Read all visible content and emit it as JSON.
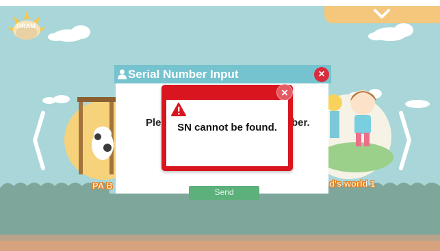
{
  "app": {
    "logo_text": "DRAM"
  },
  "carousel": {
    "left_label": "PA B",
    "right_label": "d's world 1"
  },
  "serial_dialog": {
    "title": "Serial Number Input",
    "prompt_left": "Ple",
    "prompt_right": "ber.",
    "send_label": "Send",
    "close_glyph": "×"
  },
  "alert": {
    "message": "SN cannot be found.",
    "close_glyph": "×"
  },
  "icons": {
    "top_menu": "chevron-down-icon",
    "title_icon": "user-icon",
    "alert_icon": "warning-icon",
    "nav_left": "chevron-left-icon",
    "nav_right": "chevron-right-icon"
  },
  "colors": {
    "sky": "#a9d6d8",
    "ground": "#7fa69a",
    "dialog_header": "#75c3cf",
    "alert_red": "#d9151f",
    "send_green": "#5cb07a",
    "close_red": "#d92d3f",
    "top_bar": "#f4c77d"
  }
}
